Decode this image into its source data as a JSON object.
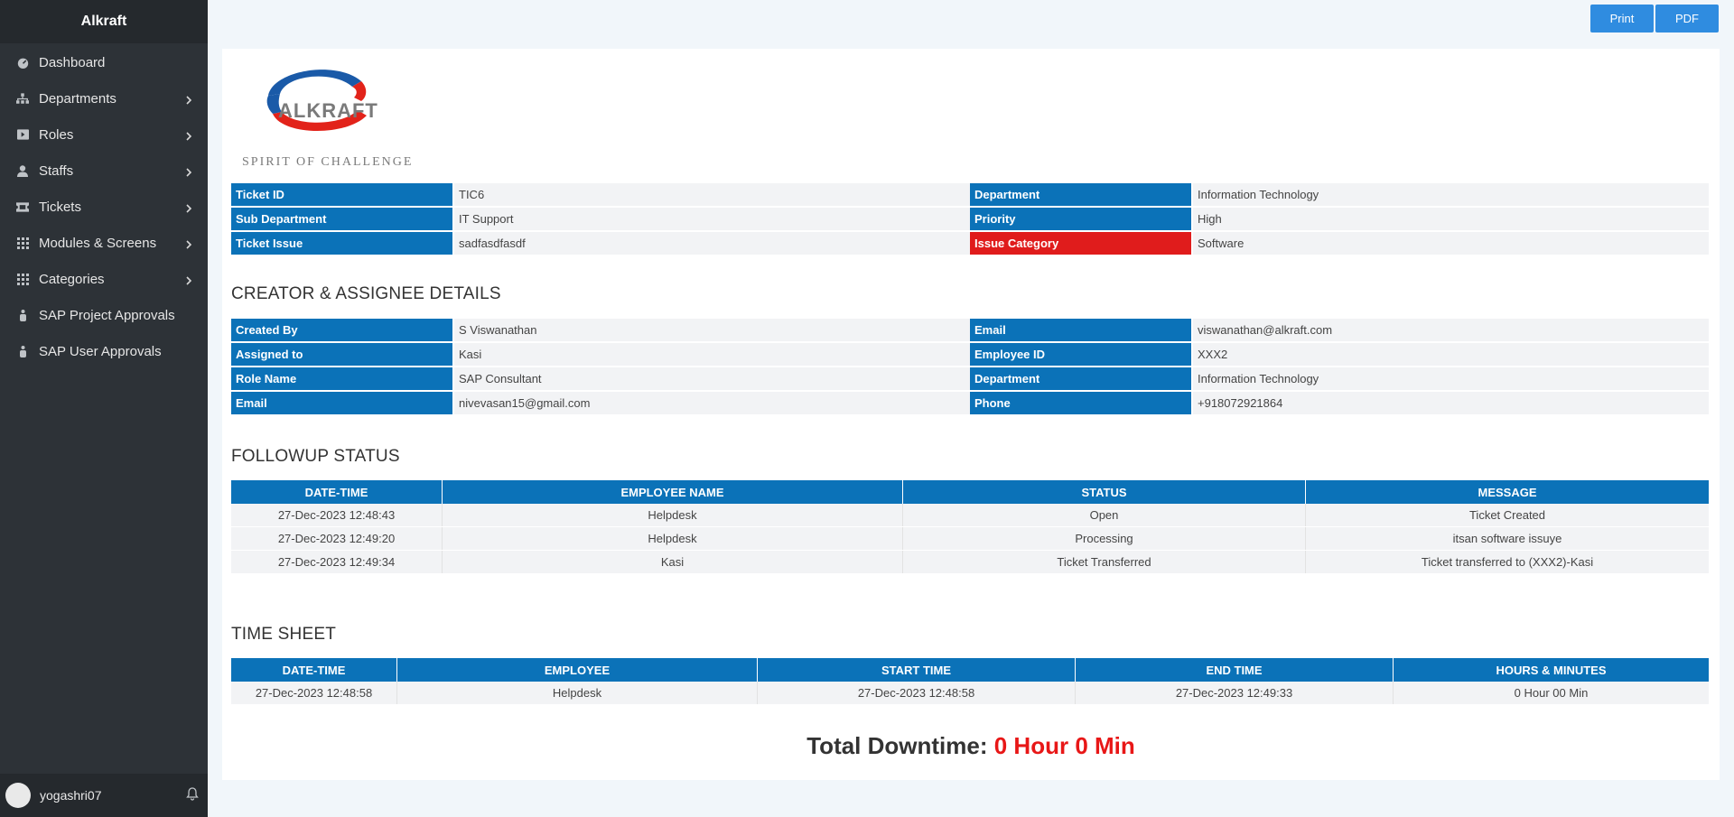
{
  "app": {
    "brand": "Alkraft"
  },
  "sidebar": {
    "items": [
      {
        "label": "Dashboard",
        "icon": "dashboard-icon",
        "has_children": false
      },
      {
        "label": "Departments",
        "icon": "sitemap-icon",
        "has_children": true
      },
      {
        "label": "Roles",
        "icon": "roles-icon",
        "has_children": true
      },
      {
        "label": "Staffs",
        "icon": "user-icon",
        "has_children": true
      },
      {
        "label": "Tickets",
        "icon": "ticket-icon",
        "has_children": true
      },
      {
        "label": "Modules & Screens",
        "icon": "grid-icon",
        "has_children": true
      },
      {
        "label": "Categories",
        "icon": "grid-icon",
        "has_children": true
      },
      {
        "label": "SAP Project Approvals",
        "icon": "person-icon",
        "has_children": false
      },
      {
        "label": "SAP User Approvals",
        "icon": "person-icon",
        "has_children": false
      }
    ],
    "user": {
      "name": "yogashri07"
    }
  },
  "toolbar": {
    "print_label": "Print",
    "pdf_label": "PDF"
  },
  "logo": {
    "name": "ALKRAFT",
    "tagline": "SPIRIT OF CHALLENGE",
    "colors": {
      "blue": "#1a5aa8",
      "red": "#e2231a"
    }
  },
  "ticket": {
    "rows": [
      {
        "k1": "Ticket ID",
        "v1": "TIC6",
        "k2": "Department",
        "v2": "Information Technology",
        "k2_alert": false
      },
      {
        "k1": "Sub Department",
        "v1": "IT Support",
        "k2": "Priority",
        "v2": "High",
        "k2_alert": false
      },
      {
        "k1": "Ticket Issue",
        "v1": "sadfasdfasdf",
        "k2": "Issue Category",
        "v2": "Software",
        "k2_alert": true
      }
    ]
  },
  "creator": {
    "title": "CREATOR & ASSIGNEE DETAILS",
    "rows": [
      {
        "k1": "Created By",
        "v1": "S Viswanathan",
        "k2": "Email",
        "v2": "viswanathan@alkraft.com"
      },
      {
        "k1": "Assigned to",
        "v1": "Kasi",
        "k2": "Employee ID",
        "v2": "XXX2"
      },
      {
        "k1": "Role Name",
        "v1": "SAP Consultant",
        "k2": "Department",
        "v2": "Information Technology"
      },
      {
        "k1": "Email",
        "v1": "nivevasan15@gmail.com",
        "k2": "Phone",
        "v2": "+918072921864"
      }
    ]
  },
  "followup": {
    "title": "FOLLOWUP STATUS",
    "columns": [
      "DATE-TIME",
      "EMPLOYEE NAME",
      "STATUS",
      "MESSAGE"
    ],
    "rows": [
      [
        "27-Dec-2023 12:48:43",
        "Helpdesk",
        "Open",
        "Ticket Created"
      ],
      [
        "27-Dec-2023 12:49:20",
        "Helpdesk",
        "Processing",
        "itsan software issuye"
      ],
      [
        "27-Dec-2023 12:49:34",
        "Kasi",
        "Ticket Transferred",
        "Ticket transferred to (XXX2)-Kasi"
      ]
    ]
  },
  "timesheet": {
    "title": "TIME SHEET",
    "columns": [
      "DATE-TIME",
      "EMPLOYEE",
      "START TIME",
      "END TIME",
      "HOURS & MINUTES"
    ],
    "rows": [
      [
        "27-Dec-2023 12:48:58",
        "Helpdesk",
        "27-Dec-2023 12:48:58",
        "27-Dec-2023 12:49:33",
        "0 Hour 00 Min"
      ]
    ]
  },
  "downtime": {
    "label": "Total Downtime:",
    "value": "0 Hour 0 Min"
  },
  "colors": {
    "header_blue": "#0b72b8",
    "alert_red": "#e01c1c",
    "button_blue": "#2f8ce0",
    "sidebar_bg": "#2d3237"
  }
}
